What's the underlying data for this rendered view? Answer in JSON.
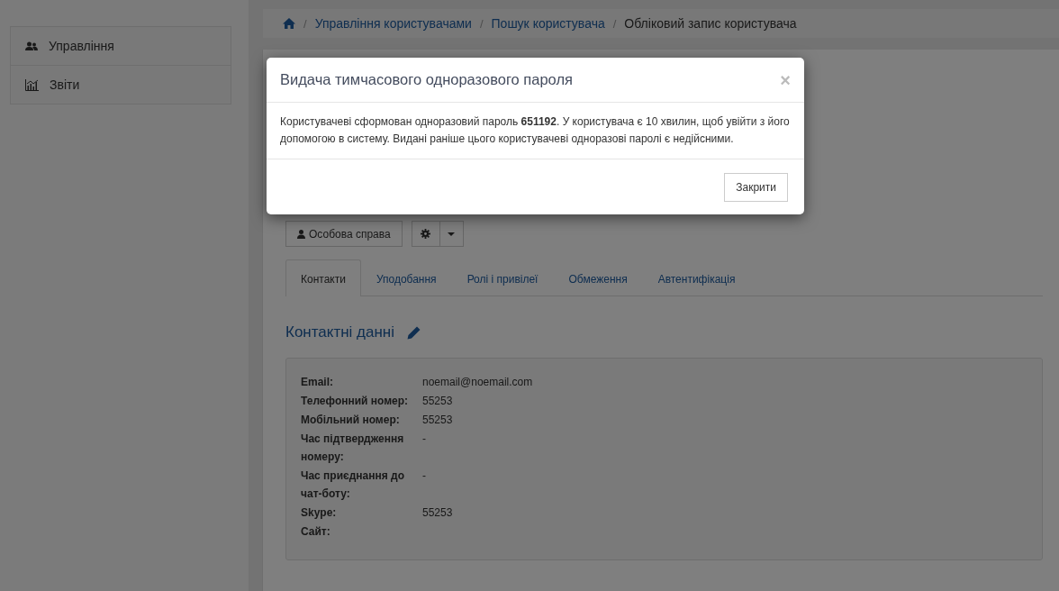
{
  "sidebar": {
    "items": [
      {
        "label": "Управління"
      },
      {
        "label": "Звіти"
      }
    ]
  },
  "breadcrumb": {
    "separator": "/",
    "items": [
      "Управління користувачами",
      "Пошук користувача",
      "Обліковий запис користувача"
    ]
  },
  "actions": {
    "profile_button": "Особова справа"
  },
  "tabs": [
    {
      "label": "Контакти",
      "selected": true
    },
    {
      "label": "Уподобання",
      "selected": false
    },
    {
      "label": "Ролі і привілеї",
      "selected": false
    },
    {
      "label": "Обмеження",
      "selected": false
    },
    {
      "label": "Автентифікація",
      "selected": false
    }
  ],
  "contacts": {
    "title": "Контактні данні",
    "rows": [
      {
        "label": "Email:",
        "value": "noemail@noemail.com"
      },
      {
        "label": "Телефонний номер:",
        "value": "55253"
      },
      {
        "label": "Мобільний номер:",
        "value": "55253"
      },
      {
        "label": "Час підтвердження номеру:",
        "value": "-"
      },
      {
        "label": "Час приєднання до чат-боту:",
        "value": "-"
      },
      {
        "label": "Skype:",
        "value": "55253"
      },
      {
        "label": "Сайт:"
      }
    ]
  },
  "modal": {
    "title": "Видача тимчасового одноразового пароля",
    "close": "×",
    "message": "Користувачеві сформован одноразовий пароль **651192**. У користувача є 10 хвилин, щоб увійти з його допомогою в систему. Видані раніше цього користувачеві одноразові паролі є недійсними.",
    "button": "Закрити"
  }
}
